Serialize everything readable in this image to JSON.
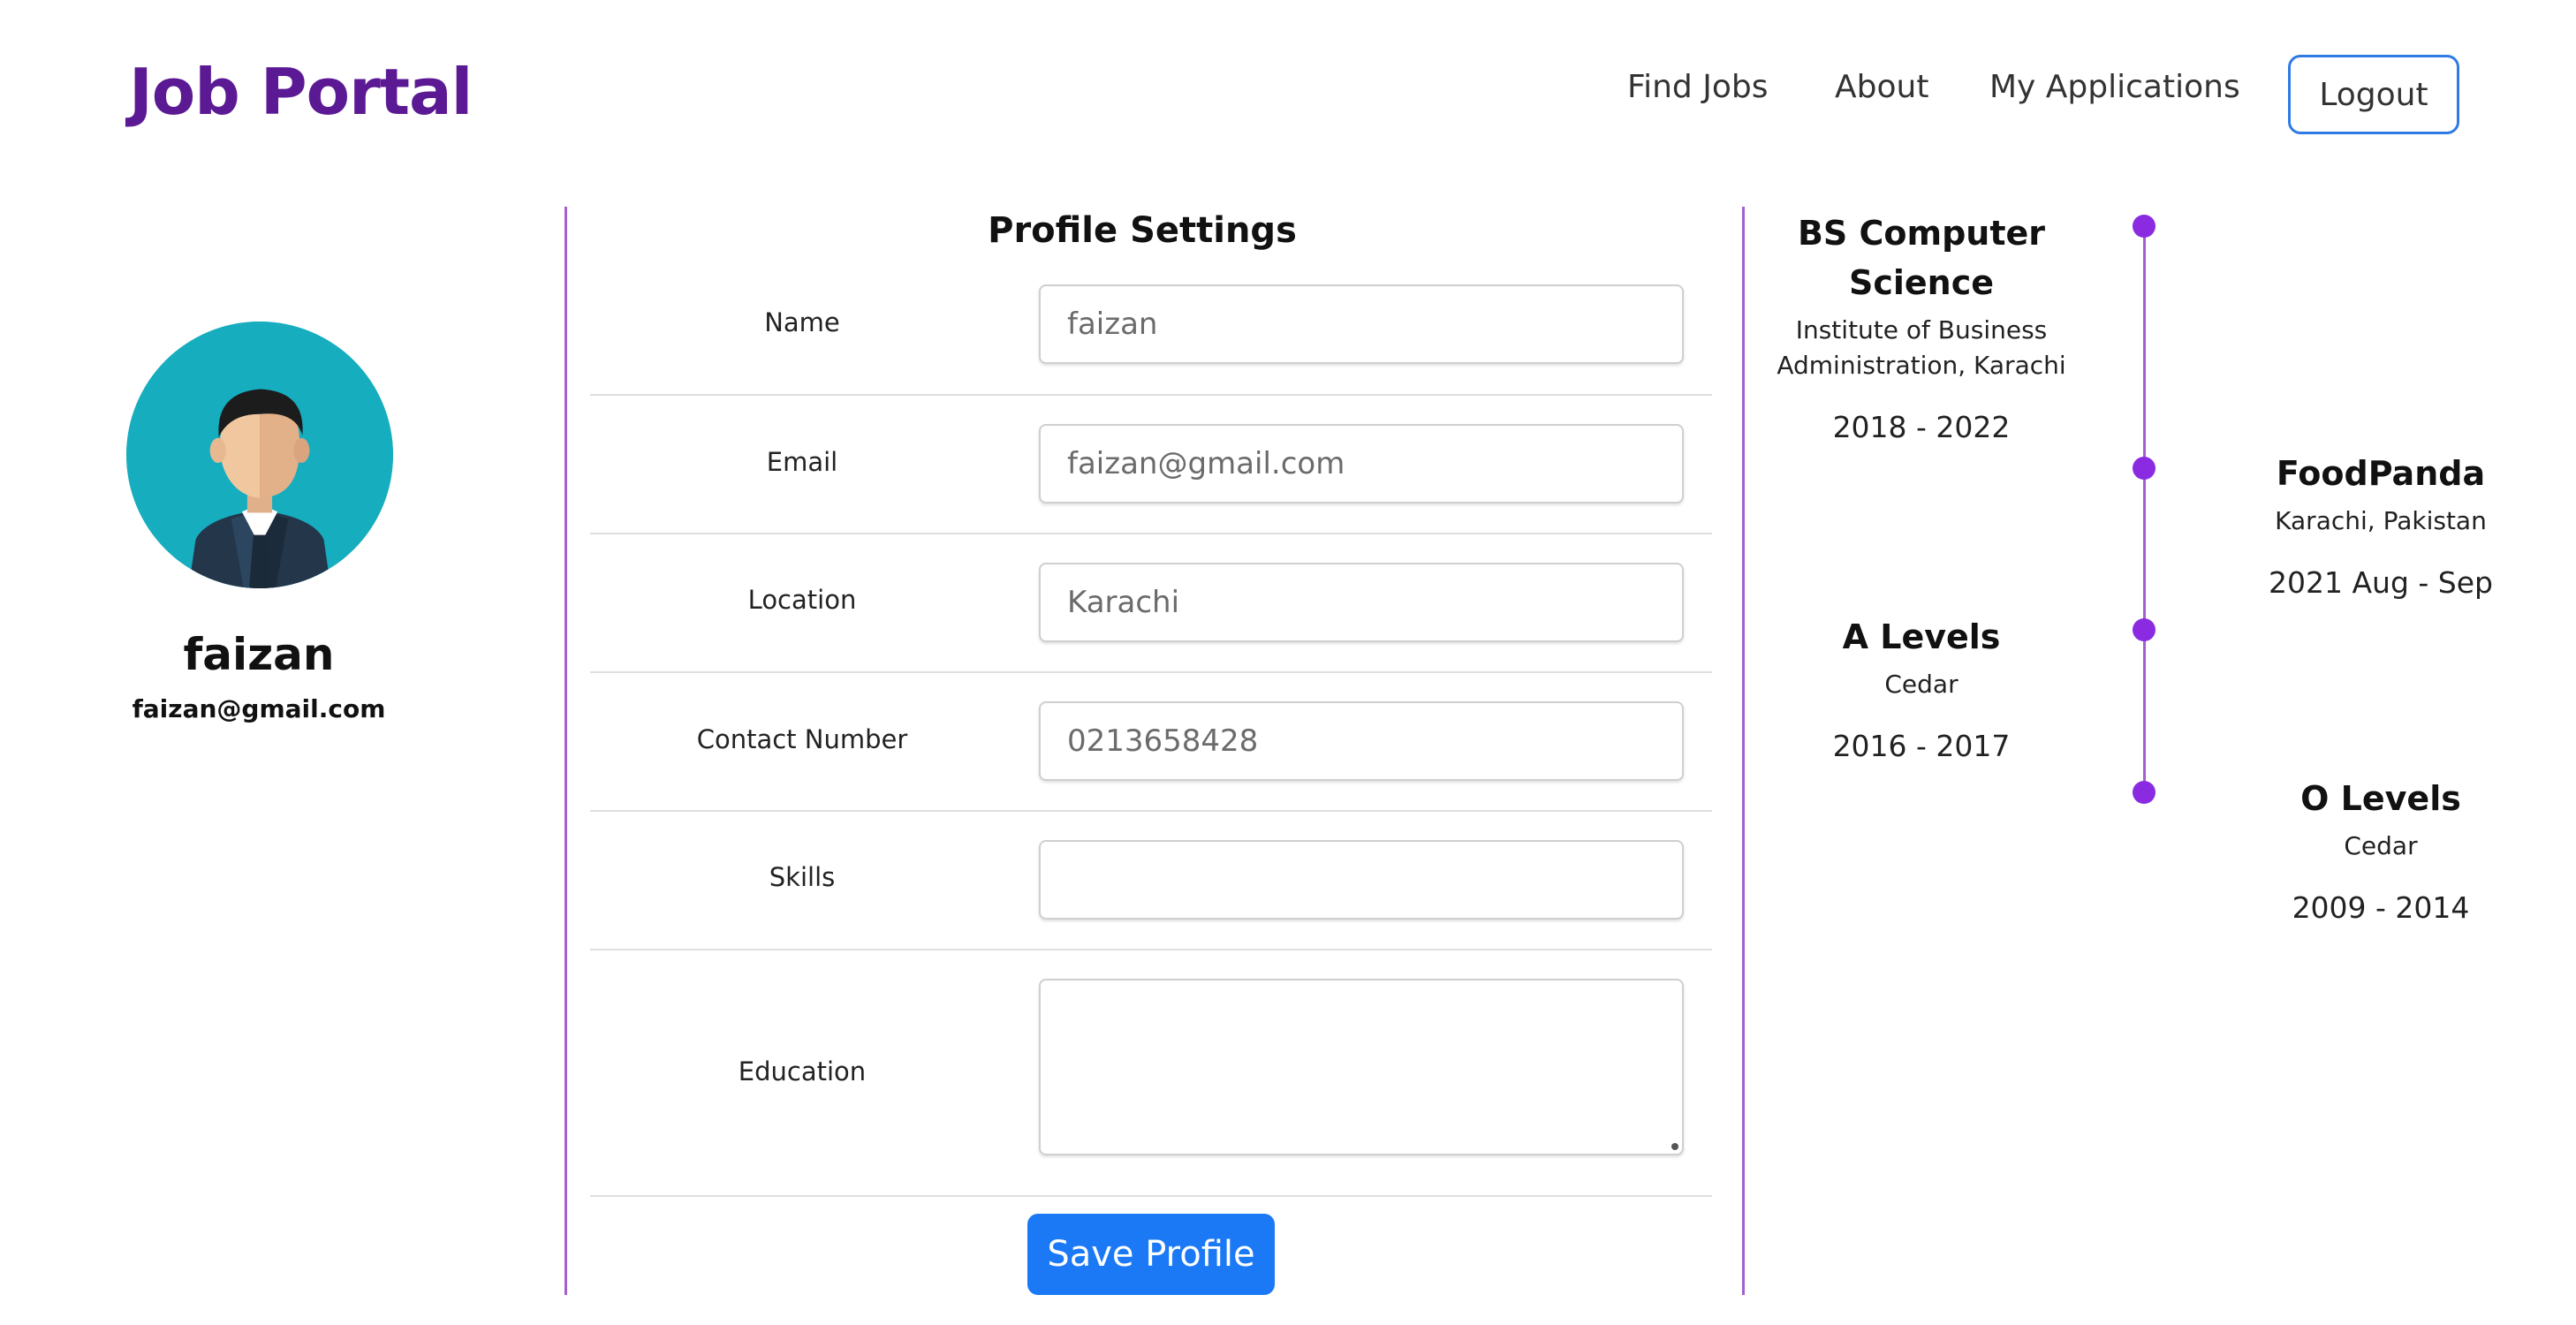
{
  "header": {
    "brand": "Job Portal",
    "nav": [
      "Find Jobs",
      "About",
      "My Applications"
    ],
    "logout_label": "Logout"
  },
  "profile": {
    "name": "faizan",
    "email": "faizan@gmail.com"
  },
  "form": {
    "title": "Profile Settings",
    "fields": [
      {
        "label": "Name",
        "placeholder": "faizan"
      },
      {
        "label": "Email",
        "placeholder": "faizan@gmail.com"
      },
      {
        "label": "Location",
        "placeholder": "Karachi"
      },
      {
        "label": "Contact Number",
        "placeholder": "0213658428"
      },
      {
        "label": "Skills",
        "placeholder": ""
      },
      {
        "label": "Education",
        "placeholder": ""
      }
    ],
    "save_label": "Save Profile"
  },
  "timeline": {
    "items": [
      {
        "title": "BS Computer Science",
        "subtitle": "Institute of Business Administration, Karachi",
        "dates": "2018 - 2022"
      },
      {
        "title": "FoodPanda",
        "subtitle": "Karachi, Pakistan",
        "dates": "2021 Aug - Sep"
      },
      {
        "title": "A Levels",
        "subtitle": "Cedar",
        "dates": "2016 - 2017"
      },
      {
        "title": "O Levels",
        "subtitle": "Cedar",
        "dates": "2009 - 2014"
      }
    ]
  },
  "colors": {
    "brand": "#5b1a94",
    "accent_line": "#a35fd0",
    "timeline_dot": "#8a2be2",
    "primary_button": "#1b79f5",
    "logout_border": "#2f7ae5",
    "avatar_bg": "#16adbf"
  },
  "icons": {
    "avatar": "user-avatar-icon"
  }
}
